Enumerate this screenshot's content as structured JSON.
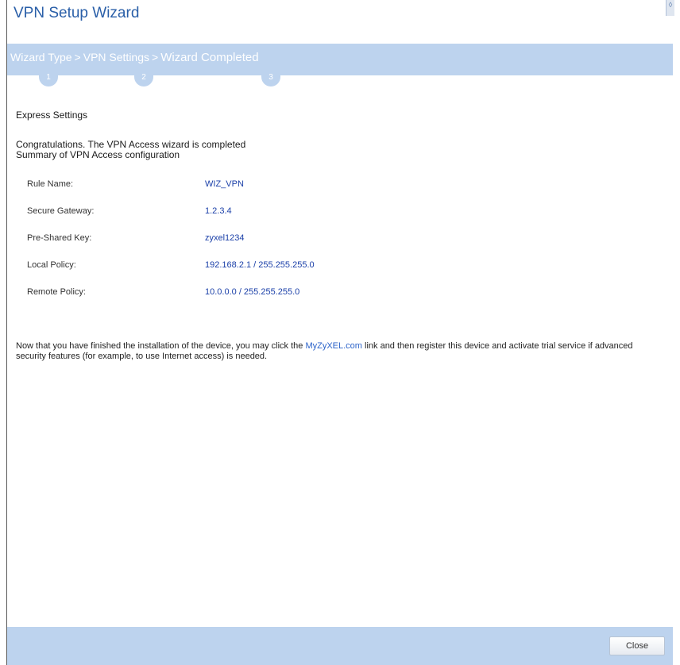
{
  "window": {
    "title": "VPN Setup Wizard"
  },
  "steps": {
    "items": [
      {
        "label": "Wizard Type",
        "number": "1"
      },
      {
        "label": "VPN Settings",
        "number": "2"
      },
      {
        "label": "Wizard Completed",
        "number": "3"
      }
    ],
    "separator": ">"
  },
  "content": {
    "section_title": "Express Settings",
    "intro_line1": "Congratulations. The VPN Access wizard is completed",
    "intro_line2": "Summary of VPN Access configuration",
    "summary": [
      {
        "label": "Rule Name:",
        "value": "WIZ_VPN"
      },
      {
        "label": "Secure Gateway:",
        "value": "1.2.3.4"
      },
      {
        "label": "Pre-Shared Key:",
        "value": "zyxel1234"
      },
      {
        "label": "Local Policy:",
        "value": "192.168.2.1 / 255.255.255.0"
      },
      {
        "label": "Remote Policy:",
        "value": "10.0.0.0 / 255.255.255.0"
      }
    ],
    "note_prefix": "Now that you have finished the installation of the device, you may click the ",
    "note_link": "MyZyXEL.com",
    "note_suffix": " link and then register this device and activate trial service if advanced security features (for example, to use Internet access) is needed."
  },
  "footer": {
    "close_label": "Close"
  }
}
